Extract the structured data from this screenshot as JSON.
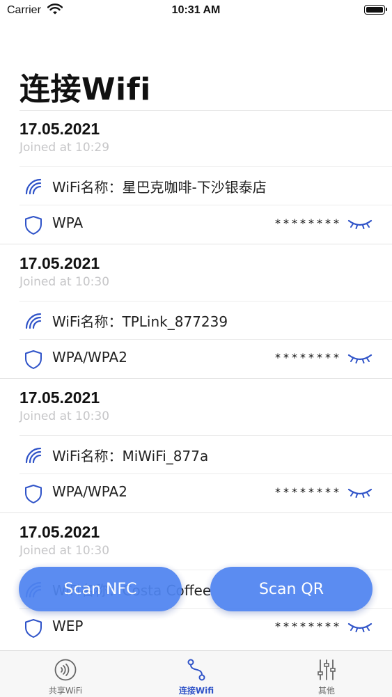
{
  "status": {
    "carrier": "Carrier",
    "time": "10:31 AM"
  },
  "page": {
    "title": "连接Wifi"
  },
  "entries": [
    {
      "date": "17.05.2021",
      "joined": "Joined at 10:29",
      "name": "WiFi名称：星巴克咖啡-下沙银泰店",
      "security": "WPA",
      "password_mask": "********"
    },
    {
      "date": "17.05.2021",
      "joined": "Joined at 10:30",
      "name": "WiFi名称：TPLink_877239",
      "security": "WPA/WPA2",
      "password_mask": "********"
    },
    {
      "date": "17.05.2021",
      "joined": "Joined at 10:30",
      "name": "WiFi名称：MiWiFi_877a",
      "security": "WPA/WPA2",
      "password_mask": "********"
    },
    {
      "date": "17.05.2021",
      "joined": "Joined at 10:30",
      "name": "WiFi名称：Costa Coffee",
      "security": "WEP",
      "password_mask": "********"
    }
  ],
  "actions": {
    "scan_nfc": "Scan NFC",
    "scan_qr": "Scan QR"
  },
  "tabs": [
    {
      "label": "共享WiFi",
      "icon": "share-wifi-icon"
    },
    {
      "label": "连接Wifi",
      "icon": "connect-route-icon",
      "active": true
    },
    {
      "label": "其他",
      "icon": "sliders-icon"
    }
  ],
  "colors": {
    "accent": "#2f53c8",
    "button": "#4f84f0",
    "muted": "#c6c6c8"
  }
}
